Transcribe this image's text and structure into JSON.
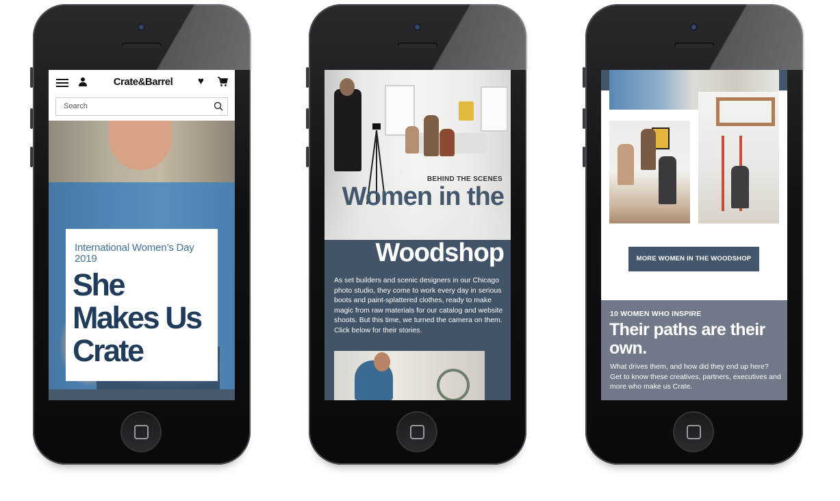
{
  "phone1": {
    "header": {
      "brand": "Crate&Barrel",
      "search_placeholder": "Search"
    },
    "hero": {
      "subtitle": "International Women’s Day 2019",
      "title": "She Makes Us Crate"
    }
  },
  "phone2": {
    "eyebrow": "BEHIND THE SCENES",
    "title_line1": "Women in the",
    "title_line2": "Woodshop",
    "body": "As set builders and scenic designers in our Chicago photo studio, they come to work every day in serious boots and paint-splattered clothes, ready to make magic from raw materials for our catalog and website shoots. But this time, we turned the camera on them. Click below for their stories."
  },
  "phone3": {
    "button_label": "MORE WOMEN IN THE WOODSHOP",
    "section_label": "10 WOMEN WHO INSPIRE",
    "section_title": "Their paths are their own.",
    "section_body": "What drives them, and how did they end up here? Get to know these creatives, partners, executives and more who make us Crate."
  },
  "colors": {
    "slate_blue": "#44566b",
    "slate_gray": "#717888",
    "title_blue": "#213c5a",
    "accent_blue": "#3f7196"
  }
}
